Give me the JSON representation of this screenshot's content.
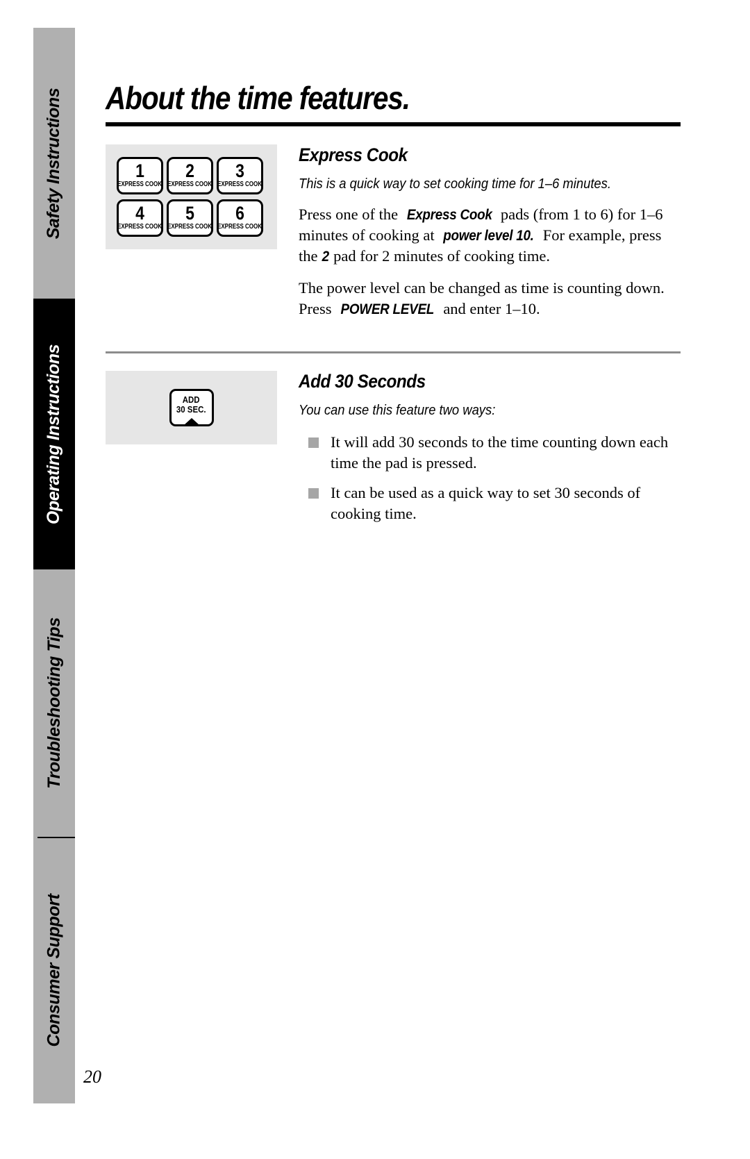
{
  "page": {
    "title": "About the time features.",
    "number": "20"
  },
  "sidebar": {
    "tabs": [
      {
        "label": "Safety Instructions",
        "active": false
      },
      {
        "label": "Operating Instructions",
        "active": true
      },
      {
        "label": "Troubleshooting Tips",
        "active": false
      },
      {
        "label": "Consumer Support",
        "active": false
      }
    ]
  },
  "sections": [
    {
      "heading": "Express Cook",
      "intro": "This is a quick way to set cooking time for 1–6 minutes.",
      "paragraphs": {
        "p1_a": "Press one of the ",
        "p1_b": "Express Cook",
        "p1_c": " pads (from 1 to 6) for 1–6 minutes of cooking at ",
        "p1_d": "power level 10.",
        "p1_e": " For example, press the ",
        "p1_f": "2",
        "p1_g": " pad for 2 minutes of cooking time.",
        "p2_a": "The power level can be changed as time is counting down. Press ",
        "p2_b": "POWER LEVEL",
        "p2_c": " and enter 1–10."
      },
      "figure": {
        "type": "express-cook-keypad",
        "pads": [
          {
            "number": "1",
            "sublabel": "EXPRESS COOK"
          },
          {
            "number": "2",
            "sublabel": "EXPRESS COOK"
          },
          {
            "number": "3",
            "sublabel": "EXPRESS COOK"
          },
          {
            "number": "4",
            "sublabel": "EXPRESS COOK"
          },
          {
            "number": "5",
            "sublabel": "EXPRESS COOK"
          },
          {
            "number": "6",
            "sublabel": "EXPRESS COOK"
          }
        ]
      }
    },
    {
      "heading": "Add 30 Seconds",
      "intro": "You can use this feature two ways:",
      "bullets": [
        "It will add 30 seconds to the time counting down each time the pad is pressed.",
        "It can be used as a quick way to set 30 seconds of cooking time."
      ],
      "figure": {
        "type": "add-30-sec-pad",
        "line1": "ADD",
        "line2": "30 SEC."
      }
    }
  ],
  "colors": {
    "tab_active_bg": "#000000",
    "tab_inactive_bg": "#b0b0b0",
    "figure_bg": "#e6e6e6",
    "bullet": "#a6a6a6",
    "rule": "#8c8c8c"
  }
}
